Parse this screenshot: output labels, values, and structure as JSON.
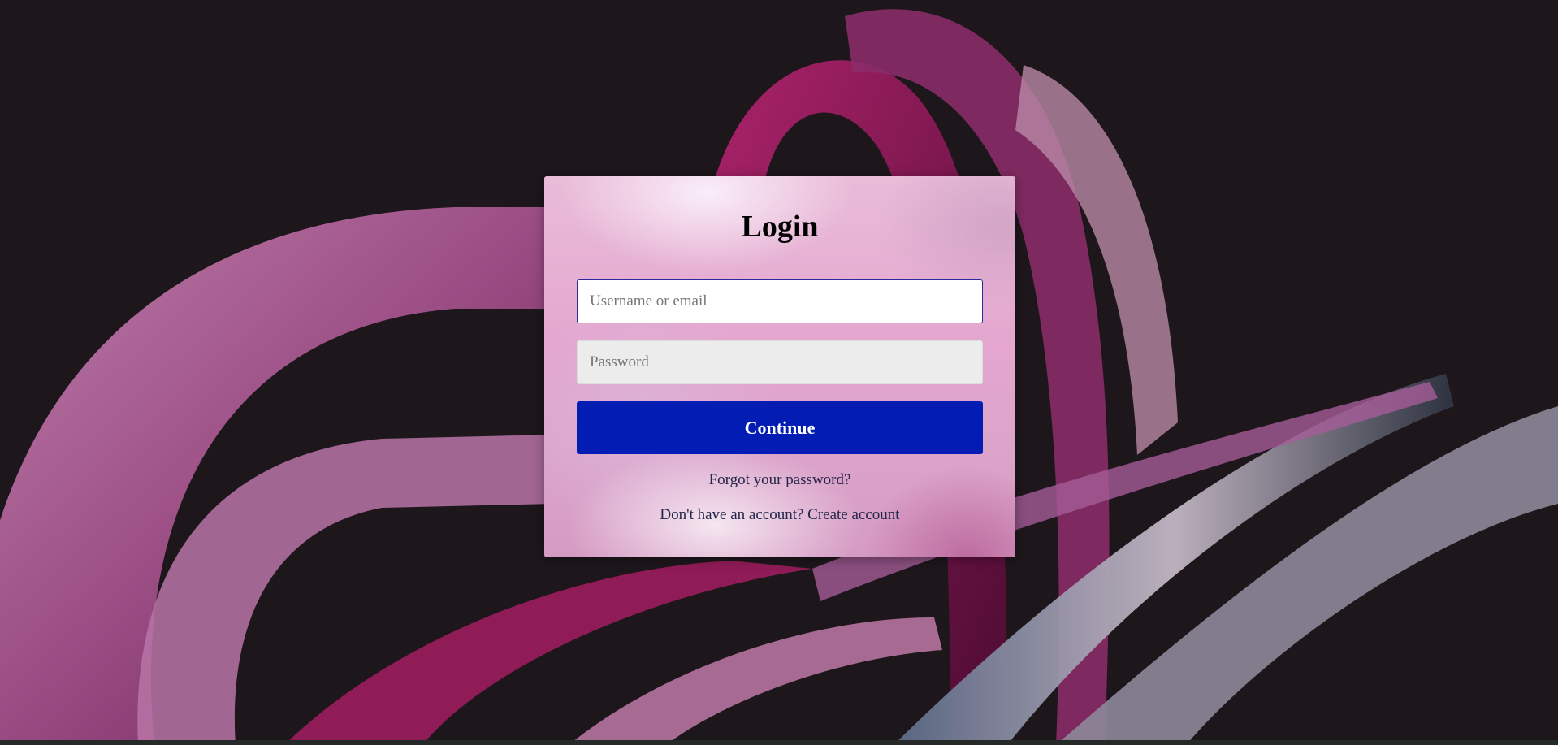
{
  "login": {
    "title": "Login",
    "username_placeholder": "Username or email",
    "password_placeholder": "Password",
    "continue_label": "Continue",
    "forgot_password": "Forgot your password?",
    "no_account_text": "Don't have an account?",
    "create_account": "Create account"
  },
  "colors": {
    "background": "#1d161b",
    "button": "#031cb4",
    "link_text": "#25254a",
    "focus_border": "#2a2a9a"
  }
}
